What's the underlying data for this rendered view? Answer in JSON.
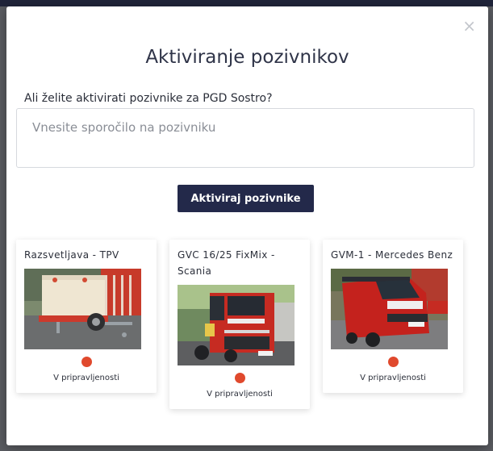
{
  "modal": {
    "close_glyph": "×",
    "title": "Aktiviranje pozivnikov",
    "question": "Ali želite aktivirati pozivnike za PGD Sostro?",
    "message_placeholder": "Vnesite sporočilo na pozivniku",
    "activate_button": "Aktiviraj pozivnike"
  },
  "vehicles": [
    {
      "name": "Razsvetljava - TPV",
      "status": "V pripravljenosti",
      "status_color": "#e0492d",
      "image": "trailer-photo"
    },
    {
      "name": "GVC 16/25 FixMix - Scania",
      "status": "V pripravljenosti",
      "status_color": "#e0492d",
      "image": "scania-fire-truck-photo"
    },
    {
      "name": "GVM-1 - Mercedes Benz",
      "status": "V pripravljenosti",
      "status_color": "#e0492d",
      "image": "mercedes-van-photo"
    }
  ],
  "colors": {
    "primary": "#23294a",
    "status_dot": "#e0492d"
  }
}
